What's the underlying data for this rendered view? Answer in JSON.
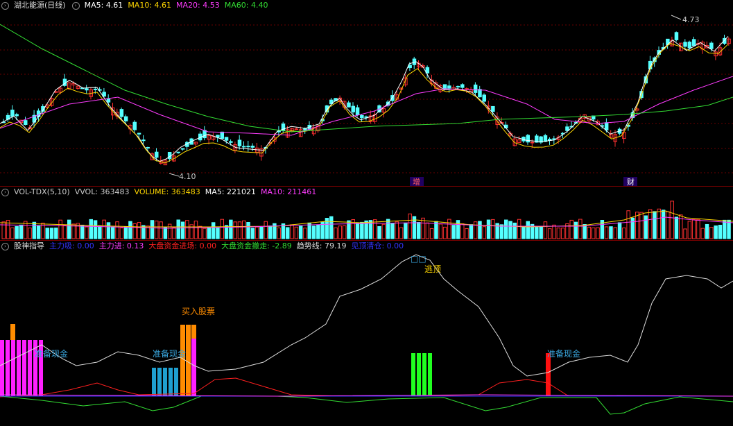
{
  "main": {
    "title": "湖北能源(日线)",
    "ma": [
      {
        "label": "MA5: 4.61",
        "color": "#ffffff"
      },
      {
        "label": "MA10: 4.61",
        "color": "#ffd700"
      },
      {
        "label": "MA20: 4.53",
        "color": "#ff3cff"
      },
      {
        "label": "MA60: 4.40",
        "color": "#33dd33"
      }
    ],
    "high_label": "4.73",
    "low_label": "4.10",
    "tag1": "增",
    "tag2": "财"
  },
  "vol": {
    "items": [
      {
        "label": "VOL-TDX(5,10)",
        "color": "#cccccc"
      },
      {
        "label": "VVOL: 363483",
        "color": "#cccccc"
      },
      {
        "label": "VOLUME: 363483",
        "color": "#ffd700"
      },
      {
        "label": "MA5: 221021",
        "color": "#ffffff"
      },
      {
        "label": "MA10: 211461",
        "color": "#ff3cff"
      }
    ]
  },
  "ind": {
    "title": "股神指导",
    "items": [
      {
        "label": "主力吸: 0.00",
        "color": "#3333ff"
      },
      {
        "label": "主力进: 0.13",
        "color": "#ff3cff"
      },
      {
        "label": "大盘资金进场: 0.00",
        "color": "#ff2020"
      },
      {
        "label": "大盘资金撤走: -2.89",
        "color": "#33dd33"
      },
      {
        "label": "趋势线: 79.19",
        "color": "#dddddd"
      },
      {
        "label": "见顶清仓: 0.00",
        "color": "#3333ff"
      }
    ],
    "ann_prepare1": "准备现金",
    "ann_prepare2": "准备现金",
    "ann_prepare3": "准备现金",
    "ann_buy": "买入股票",
    "ann_top": "逃顶",
    "ann_box": "□□"
  },
  "chart_data": [
    {
      "type": "candlestick",
      "title": "湖北能源(日线)",
      "ylim": [
        4.05,
        4.78
      ],
      "annotations": [
        {
          "label": "4.73",
          "type": "high"
        },
        {
          "label": "4.10",
          "type": "low"
        }
      ],
      "series": [
        {
          "name": "MA5",
          "last": 4.61
        },
        {
          "name": "MA10",
          "last": 4.61
        },
        {
          "name": "MA20",
          "last": 4.53
        },
        {
          "name": "MA60",
          "last": 4.4
        }
      ]
    },
    {
      "type": "bar",
      "title": "VOL-TDX(5,10)",
      "series": [
        {
          "name": "VOLUME",
          "last": 363483
        },
        {
          "name": "MA5",
          "last": 221021
        },
        {
          "name": "MA10",
          "last": 211461
        }
      ]
    },
    {
      "type": "line",
      "title": "股神指导",
      "series": [
        {
          "name": "主力吸",
          "last": 0.0
        },
        {
          "name": "主力进",
          "last": 0.13
        },
        {
          "name": "大盘资金进场",
          "last": 0.0
        },
        {
          "name": "大盘资金撤走",
          "last": -2.89
        },
        {
          "name": "趋势线",
          "last": 79.19
        },
        {
          "name": "见顶清仓",
          "last": 0.0
        }
      ]
    }
  ]
}
